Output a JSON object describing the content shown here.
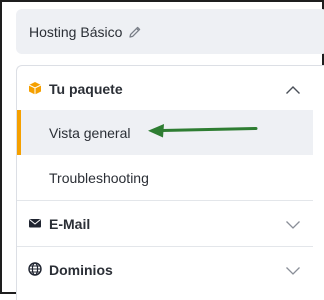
{
  "hosting": {
    "title": "Hosting Básico",
    "edit_icon": "pencil-icon"
  },
  "menu": {
    "package": {
      "label": "Tu paquete",
      "icon": "box-icon",
      "expanded": true,
      "icon_color": "#f5a000"
    },
    "package_items": [
      {
        "label": "Vista general",
        "active": true
      },
      {
        "label": "Troubleshooting",
        "active": false
      }
    ],
    "email": {
      "label": "E-Mail",
      "icon": "envelope-icon",
      "expanded": false
    },
    "domains": {
      "label": "Dominios",
      "icon": "globe-icon",
      "expanded": false
    }
  },
  "colors": {
    "accent": "#f5a000",
    "annotation_arrow": "#2e7d32",
    "active_bg": "#eef0f4"
  }
}
